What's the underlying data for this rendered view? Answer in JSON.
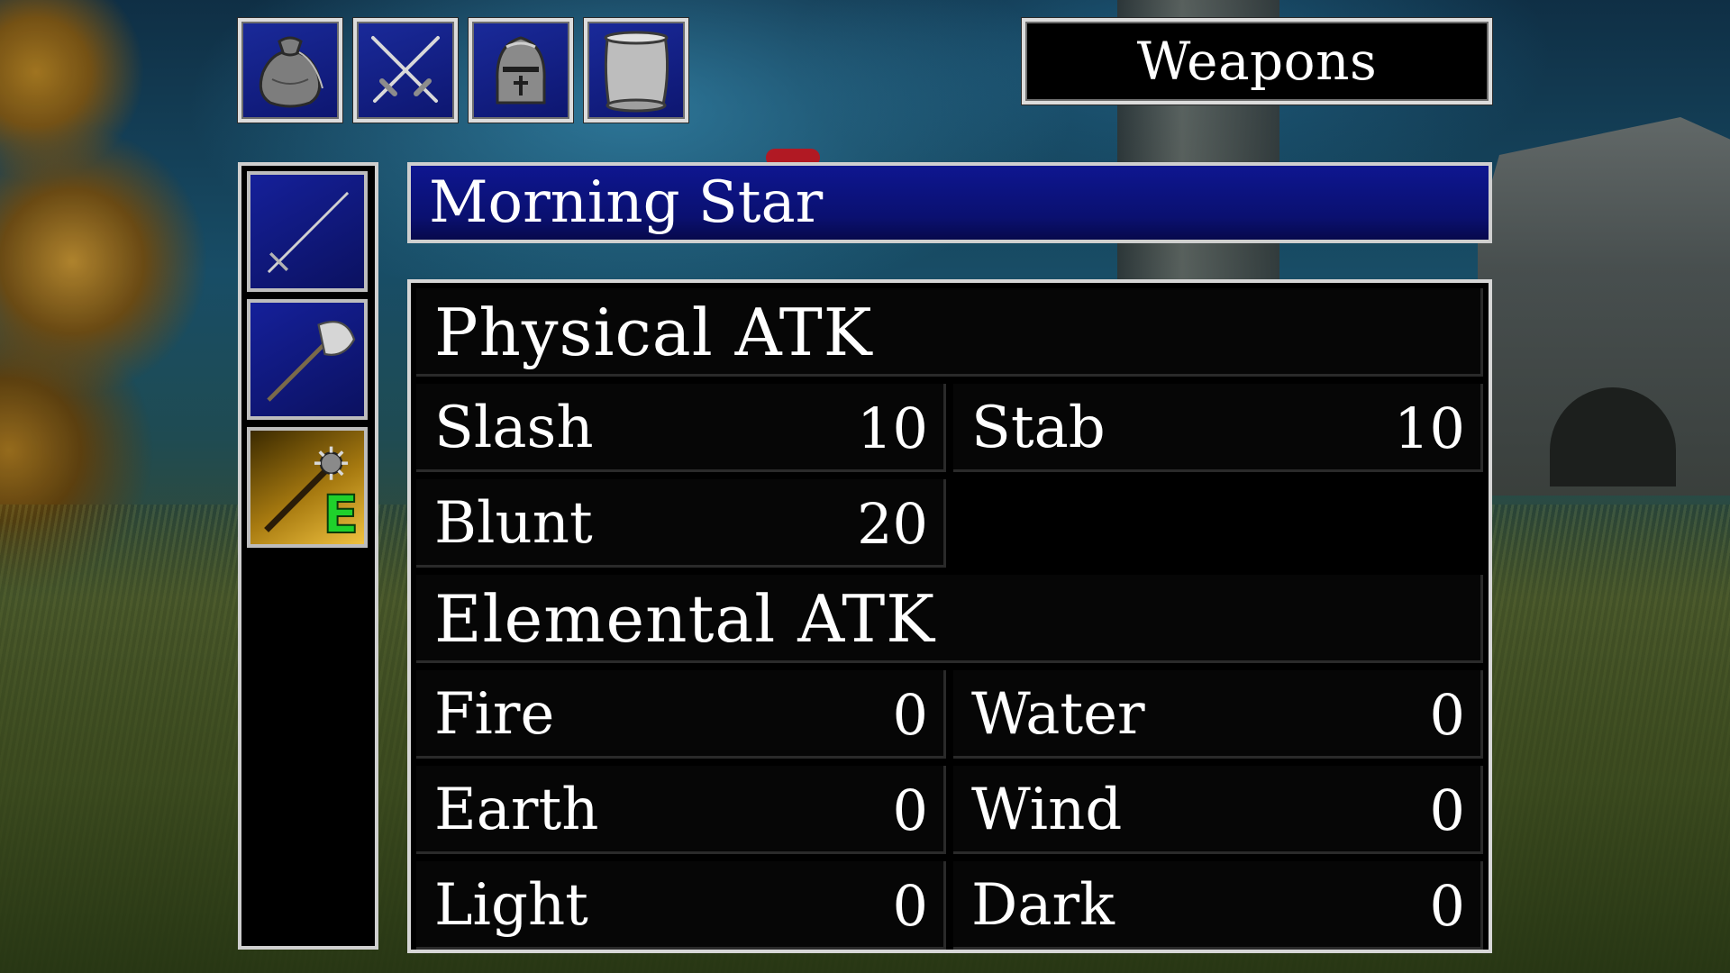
{
  "tabs": [
    {
      "icon": "pouch-icon"
    },
    {
      "icon": "crossed-swords-icon"
    },
    {
      "icon": "helmet-icon"
    },
    {
      "icon": "scroll-icon"
    }
  ],
  "category": "Weapons",
  "item_list": [
    {
      "icon": "sword-icon",
      "selected": false,
      "equipped": false
    },
    {
      "icon": "battle-axe-icon",
      "selected": false,
      "equipped": false
    },
    {
      "icon": "morning-star-icon",
      "selected": true,
      "equipped": true
    }
  ],
  "equipped_badge": "E",
  "item_name": "Morning Star",
  "stats": {
    "physical_header": "Physical ATK",
    "slash_label": "Slash",
    "slash_value": "10",
    "stab_label": "Stab",
    "stab_value": "10",
    "blunt_label": "Blunt",
    "blunt_value": "20",
    "elemental_header": "Elemental ATK",
    "fire_label": "Fire",
    "fire_value": "0",
    "water_label": "Water",
    "water_value": "0",
    "earth_label": "Earth",
    "earth_value": "0",
    "wind_label": "Wind",
    "wind_value": "0",
    "light_label": "Light",
    "light_value": "0",
    "dark_label": "Dark",
    "dark_value": "0"
  },
  "colors": {
    "panel_blue": "#0e1690",
    "selected_gold": "#f0c240",
    "equip_green": "#1fd12b"
  }
}
